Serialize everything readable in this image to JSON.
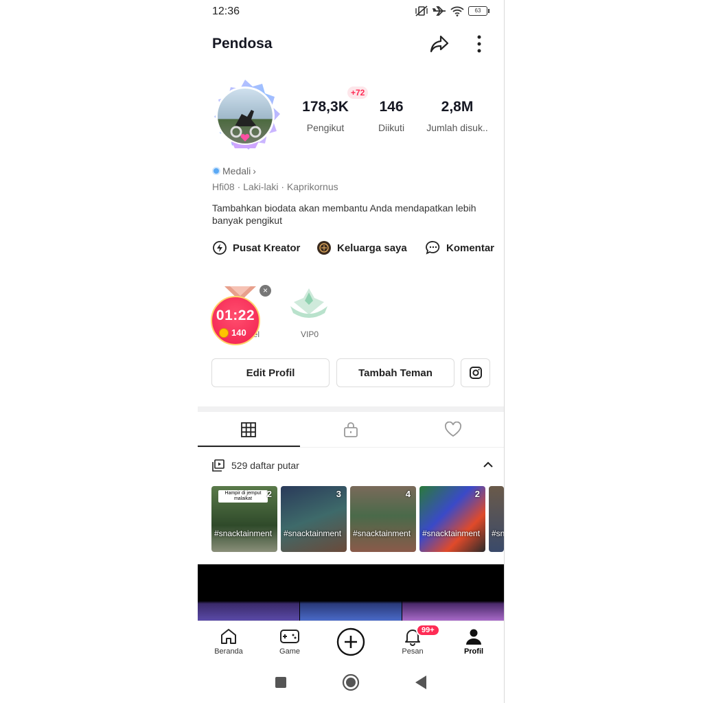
{
  "status_bar": {
    "time": "12:36",
    "battery": "63"
  },
  "profile": {
    "username": "Pendosa",
    "followers_delta": "+72",
    "stats": [
      {
        "value": "178,3K",
        "label": "Pengikut"
      },
      {
        "value": "146",
        "label": "Diikuti"
      },
      {
        "value": "2,8M",
        "label": "Jumlah disuk.."
      }
    ],
    "medal_label": "Medali",
    "medal_chevron": "›",
    "info": "Hfi08 · Laki-laki · Kaprikornus",
    "bio": "Tambahkan biodata akan membantu Anda mendapatkan lebih banyak pengikut"
  },
  "links": [
    {
      "label": "Pusat Kreator",
      "icon": "lightning-icon"
    },
    {
      "label": "Keluarga saya",
      "icon": "family-icon"
    },
    {
      "label": "Komentar",
      "icon": "comment-icon"
    }
  ],
  "badges": {
    "timer": "01:22",
    "coins": "140",
    "level_label": "evel",
    "vip_label": "VIP0",
    "close": "×"
  },
  "buttons": {
    "edit_profile": "Edit Profil",
    "add_friend": "Tambah Teman"
  },
  "tabs": [
    "grid-icon",
    "lock-icon",
    "heart-icon"
  ],
  "playlist": {
    "title": "529 daftar putar",
    "items": [
      {
        "number": "2",
        "caption": "Hampir di jemput malaikat",
        "tag": "#snacktainment"
      },
      {
        "number": "3",
        "caption": "",
        "tag": "#snacktainment"
      },
      {
        "number": "4",
        "caption": "",
        "tag": "#snacktainment"
      },
      {
        "number": "2",
        "caption": "",
        "tag": "#snacktainment"
      },
      {
        "number": "",
        "caption": "",
        "tag": "#sn"
      }
    ]
  },
  "bottom_nav": [
    {
      "label": "Beranda",
      "icon": "home-icon"
    },
    {
      "label": "Game",
      "icon": "gamepad-icon"
    },
    {
      "label": "",
      "icon": "plus-icon"
    },
    {
      "label": "Pesan",
      "icon": "bell-icon"
    },
    {
      "label": "Profil",
      "icon": "person-icon"
    }
  ],
  "notifications_badge": "99+",
  "colors": {
    "accent": "#fe2c55",
    "text": "#161823"
  }
}
